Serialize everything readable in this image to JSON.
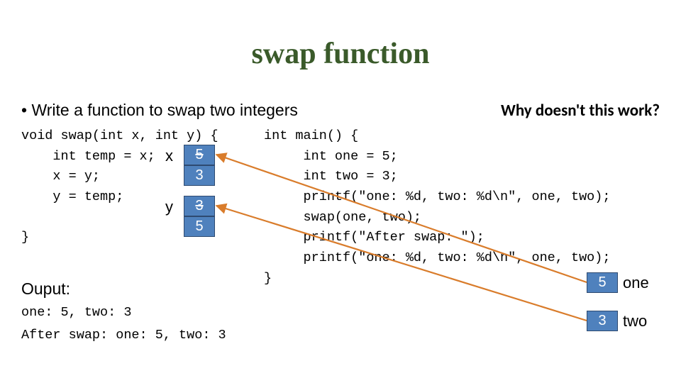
{
  "title": "swap function",
  "bullet": "• Write a function to swap two integers",
  "why": "Why doesn't this work?",
  "code_left": "void swap(int x, int y) {\n    int temp = x;\n    x = y;\n    y = temp;\n\n}",
  "code_right": "int main() {\n     int one = 5;\n     int two = 3;\n     printf(\"one: %d, two: %d\\n\", one, two);\n     swap(one, two);\n     printf(\"After swap: \");\n     printf(\"one: %d, two: %d\\n\", one, two);\n}",
  "labels": {
    "x": "x",
    "y": "y",
    "one": "one",
    "two": "two"
  },
  "boxes": {
    "x_old": "5",
    "x_new": "3",
    "y_old": "3",
    "y_new": "5",
    "one": "5",
    "two": "3"
  },
  "output_heading": "Ouput:",
  "output_lines": {
    "l1": "one: 5, two: 3",
    "l2": "After swap: one: 5, two: 3"
  }
}
